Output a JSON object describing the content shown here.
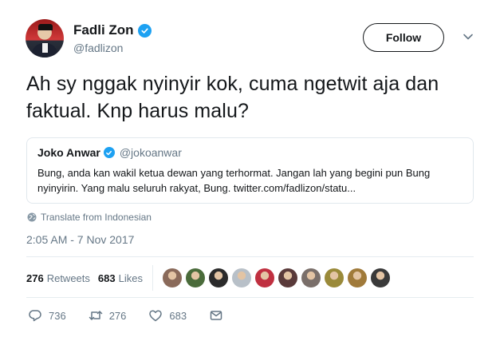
{
  "author": {
    "display_name": "Fadli Zon",
    "handle": "@fadlizon",
    "verified": true
  },
  "follow_label": "Follow",
  "tweet_text": "Ah sy nggak nyinyir kok, cuma ngetwit aja dan faktual. Knp harus malu?",
  "quoted": {
    "display_name": "Joko Anwar",
    "handle": "@jokoanwar",
    "verified": true,
    "text": "Bung, anda kan wakil ketua dewan yang terhormat. Jangan lah yang begini pun Bung nyinyirin. Yang malu seluruh rakyat, Bung. twitter.com/fadlizon/statu..."
  },
  "translate_label": "Translate from Indonesian",
  "timestamp": "2:05 AM - 7 Nov 2017",
  "stats": {
    "retweets_count": "276",
    "retweets_label": "Retweets",
    "likes_count": "683",
    "likes_label": "Likes"
  },
  "liker_avatar_colors": [
    "#8a6a5a",
    "#4a6b3a",
    "#2b2b2b",
    "#b8c0c8",
    "#c03040",
    "#5a3a3a",
    "#7a6f6a",
    "#9a8a3a",
    "#a07a3a",
    "#3a3a3a"
  ],
  "actions": {
    "replies": "736",
    "retweets": "276",
    "likes": "683"
  },
  "colors": {
    "verified_blue": "#1da1f2",
    "secondary_text": "#657786",
    "border": "#e1e8ed"
  }
}
